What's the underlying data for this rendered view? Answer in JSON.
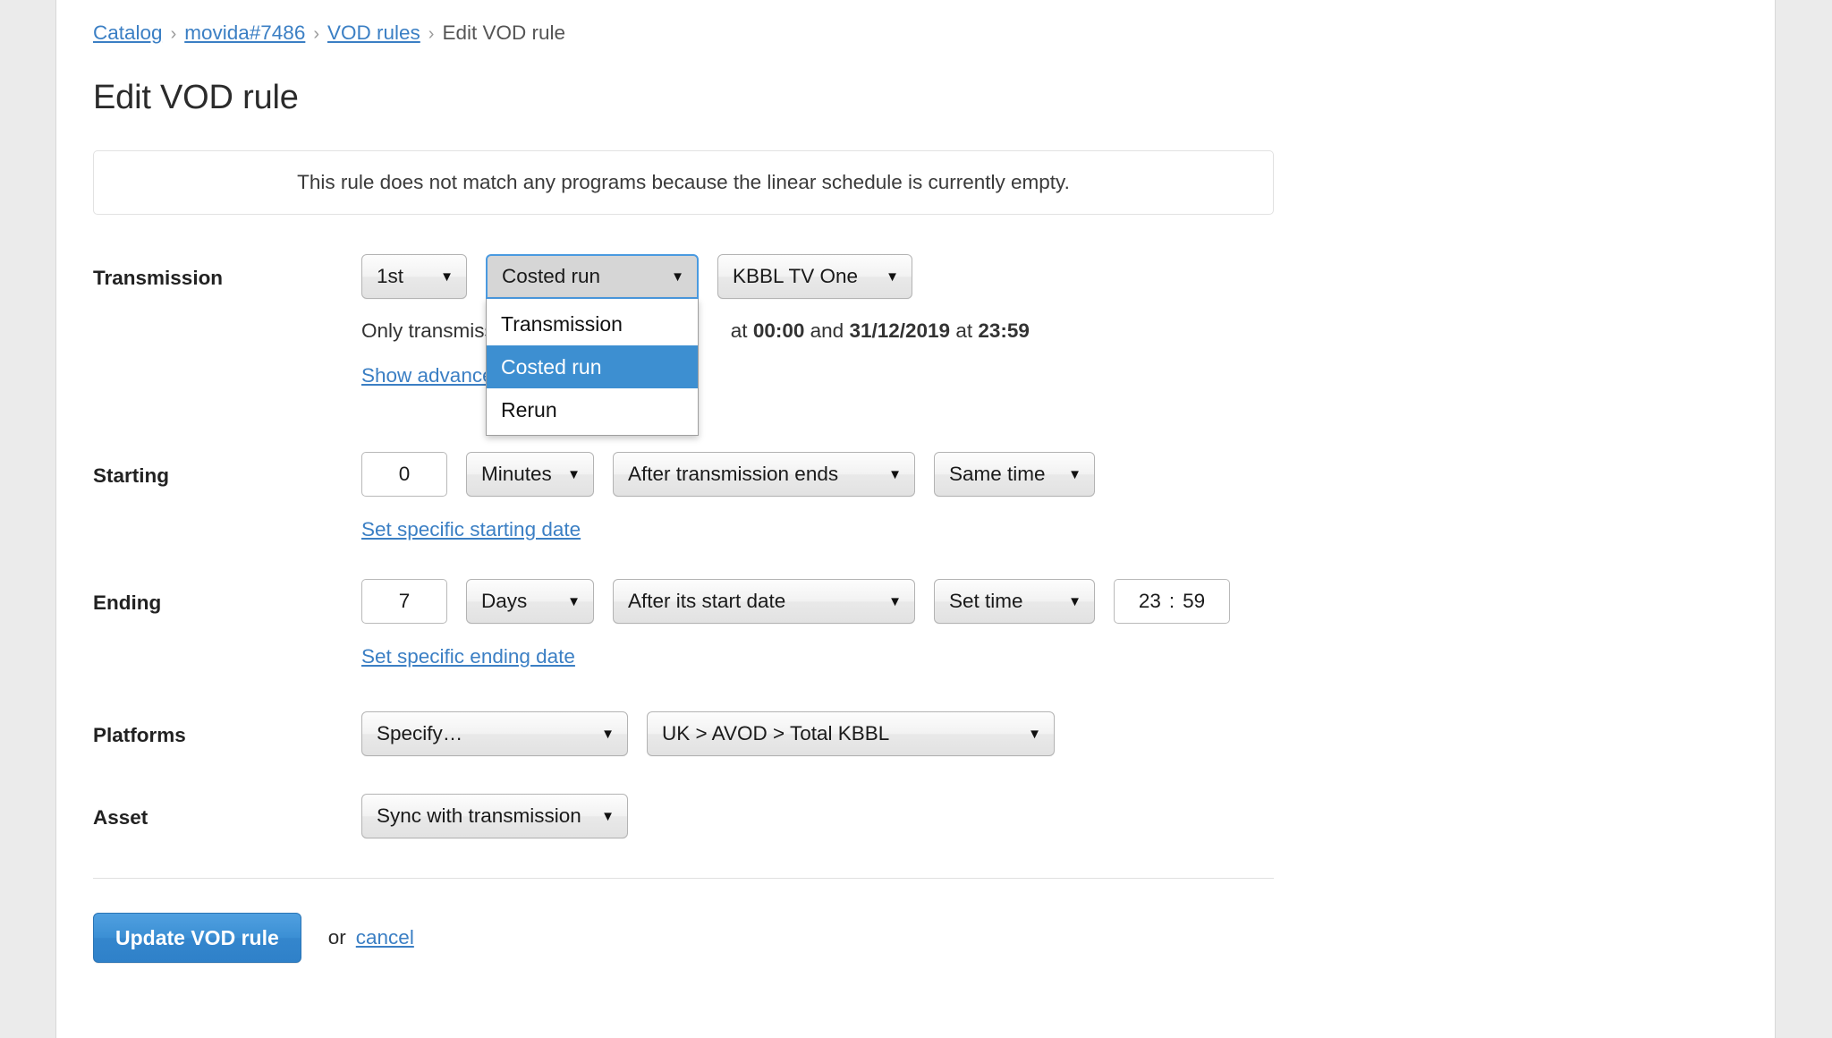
{
  "breadcrumb": {
    "items": [
      {
        "label": "Catalog",
        "link": true
      },
      {
        "label": "movida#7486",
        "link": true
      },
      {
        "label": "VOD rules",
        "link": true
      },
      {
        "label": "Edit VOD rule",
        "link": false
      }
    ],
    "separator": "›"
  },
  "page": {
    "title": "Edit VOD rule"
  },
  "alert": {
    "message": "This rule does not match any programs because the linear schedule is currently empty."
  },
  "form": {
    "transmission": {
      "label": "Transmission",
      "ordinal_value": "1st",
      "type_value": "Costed run",
      "channel_value": "KBBL TV One",
      "helper_prefix": "Only transmissi",
      "helper_at_1": "at",
      "helper_time_1": "00:00",
      "helper_and": "and",
      "helper_date_2": "31/12/2019",
      "helper_at_2": "at",
      "helper_time_2": "23:59",
      "advanced_link": "Show advanced",
      "dropdown_options": [
        "Transmission",
        "Costed run",
        "Rerun"
      ],
      "dropdown_selected": "Costed run"
    },
    "starting": {
      "label": "Starting",
      "offset_value": "0",
      "unit_value": "Minutes",
      "anchor_value": "After transmission ends",
      "time_value": "Same time",
      "specific_date_link": "Set specific starting date"
    },
    "ending": {
      "label": "Ending",
      "offset_value": "7",
      "unit_value": "Days",
      "anchor_value": "After its start date",
      "time_value": "Set time",
      "time_hours": "23",
      "time_colon": ":",
      "time_minutes": "59",
      "specific_date_link": "Set specific ending date"
    },
    "platforms": {
      "label": "Platforms",
      "mode_value": "Specify…",
      "platform_value": "UK > AVOD > Total KBBL"
    },
    "asset": {
      "label": "Asset",
      "sync_value": "Sync with transmission"
    }
  },
  "footer": {
    "submit_label": "Update VOD rule",
    "or_label": "or",
    "cancel_label": "cancel"
  },
  "icons": {
    "caret_down": "▼"
  },
  "colors": {
    "link": "#3b7fc4",
    "primary_button": "#3b8fd4",
    "dropdown_highlight": "#3d8fd1",
    "focus_border": "#4a9ae0",
    "page_background": "#ebebeb",
    "panel_background": "#ffffff"
  }
}
